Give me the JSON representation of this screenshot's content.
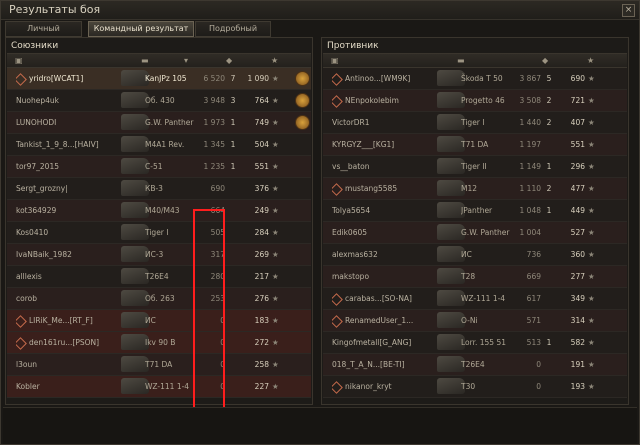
{
  "window": {
    "title": "Результаты боя",
    "close_label": "×"
  },
  "tabs": [
    {
      "label": "Личный результат",
      "active": false
    },
    {
      "label": "Командный результат",
      "active": true
    },
    {
      "label": "Подробный отчёт",
      "active": false
    }
  ],
  "allies": {
    "title": "Союзники",
    "rows": [
      {
        "player": "yridro[WCAT1]",
        "vehicle": "KanJPz 105",
        "damage": "6 520",
        "kills": "7",
        "xp": "1 090",
        "style": "sel",
        "clan": true,
        "medal": true
      },
      {
        "player": "Nuohep4uk",
        "vehicle": "Об. 430",
        "damage": "3 948",
        "kills": "3",
        "xp": "764",
        "style": "",
        "medal": true
      },
      {
        "player": "LUNOHODI",
        "vehicle": "G.W. Panther",
        "damage": "1 973",
        "kills": "1",
        "xp": "749",
        "style": "alt",
        "medal": true
      },
      {
        "player": "Tankist_1_9_8...[HAIV]",
        "vehicle": "M4A1 Rev.",
        "damage": "1 345",
        "kills": "1",
        "xp": "504",
        "style": ""
      },
      {
        "player": "tor97_2015",
        "vehicle": "C-51",
        "damage": "1 235",
        "kills": "1",
        "xp": "551",
        "style": "alt"
      },
      {
        "player": "Sergt_grozny|",
        "vehicle": "КВ-3",
        "damage": "690",
        "kills": "",
        "xp": "376",
        "style": ""
      },
      {
        "player": "kot364929",
        "vehicle": "M40/M43",
        "damage": "664",
        "kills": "",
        "xp": "249",
        "style": "alt"
      },
      {
        "player": "Kos0410",
        "vehicle": "Tiger I",
        "damage": "505",
        "kills": "",
        "xp": "284",
        "style": ""
      },
      {
        "player": "IvaNBaik_1982",
        "vehicle": "ИС-3",
        "damage": "317",
        "kills": "",
        "xp": "269",
        "style": "alt"
      },
      {
        "player": "alllexis",
        "vehicle": "T26E4",
        "damage": "280",
        "kills": "",
        "xp": "217",
        "style": ""
      },
      {
        "player": "corob",
        "vehicle": "Об. 263",
        "damage": "253",
        "kills": "",
        "xp": "276",
        "style": "alt"
      },
      {
        "player": "LIRiK_Me...[RT_F]",
        "vehicle": "ИС",
        "damage": "0",
        "kills": "",
        "xp": "183",
        "style": "red",
        "clan": true
      },
      {
        "player": "den161ru...[PSON]",
        "vehicle": "Ikv 90 B",
        "damage": "0",
        "kills": "",
        "xp": "272",
        "style": "red",
        "clan": true
      },
      {
        "player": "l3oun",
        "vehicle": "T71 DA",
        "damage": "0",
        "kills": "",
        "xp": "258",
        "style": "alt"
      },
      {
        "player": "Kobler",
        "vehicle": "WZ-111 1-4",
        "damage": "0",
        "kills": "",
        "xp": "227",
        "style": "red"
      }
    ]
  },
  "enemies": {
    "title": "Противник",
    "rows": [
      {
        "player": "Antinoo...[WM9K]",
        "vehicle": "Škoda T 50",
        "damage": "3 867",
        "kills": "5",
        "xp": "690",
        "style": "",
        "clan": true
      },
      {
        "player": "NEnpokolebim",
        "vehicle": "Progetto 46",
        "damage": "3 508",
        "kills": "2",
        "xp": "721",
        "style": "alt",
        "clan": true
      },
      {
        "player": "VictorDR1",
        "vehicle": "Tiger I",
        "damage": "1 440",
        "kills": "2",
        "xp": "407",
        "style": ""
      },
      {
        "player": "KYRGYZ___[KG1]",
        "vehicle": "T71 DA",
        "damage": "1 197",
        "kills": "",
        "xp": "551",
        "style": "alt"
      },
      {
        "player": "vs__baton",
        "vehicle": "Tiger II",
        "damage": "1 149",
        "kills": "1",
        "xp": "296",
        "style": ""
      },
      {
        "player": "mustang5585",
        "vehicle": "M12",
        "damage": "1 110",
        "kills": "2",
        "xp": "477",
        "style": "alt",
        "clan": true
      },
      {
        "player": "Tolya5654",
        "vehicle": "JPanther",
        "damage": "1 048",
        "kills": "1",
        "xp": "449",
        "style": ""
      },
      {
        "player": "Edik0605",
        "vehicle": "G.W. Panther",
        "damage": "1 004",
        "kills": "",
        "xp": "527",
        "style": "alt"
      },
      {
        "player": "alexmas632",
        "vehicle": "ИС",
        "damage": "736",
        "kills": "",
        "xp": "360",
        "style": ""
      },
      {
        "player": "makstopo",
        "vehicle": "T28",
        "damage": "669",
        "kills": "",
        "xp": "277",
        "style": "alt"
      },
      {
        "player": "carabas...[SO-NA]",
        "vehicle": "WZ-111 1-4",
        "damage": "617",
        "kills": "",
        "xp": "349",
        "style": "",
        "clan": true
      },
      {
        "player": "RenamedUser_1...",
        "vehicle": "O-Ni",
        "damage": "571",
        "kills": "",
        "xp": "314",
        "style": "alt",
        "clan": true
      },
      {
        "player": "Kingofmetall[G_ANG]",
        "vehicle": "Lorr. 155 51",
        "damage": "513",
        "kills": "1",
        "xp": "582",
        "style": ""
      },
      {
        "player": "018_T_A_N...[BE-TI]",
        "vehicle": "T26E4",
        "damage": "0",
        "kills": "",
        "xp": "191",
        "style": "alt"
      },
      {
        "player": "nikanor_kryt",
        "vehicle": "T30",
        "damage": "0",
        "kills": "",
        "xp": "193",
        "style": "",
        "clan": true
      }
    ]
  },
  "icons": [
    "close-icon",
    "platoon-icon",
    "tank-icon",
    "sort-icon",
    "damage-icon",
    "star-icon",
    "medal-icon"
  ],
  "accent": "#ff1d1d"
}
